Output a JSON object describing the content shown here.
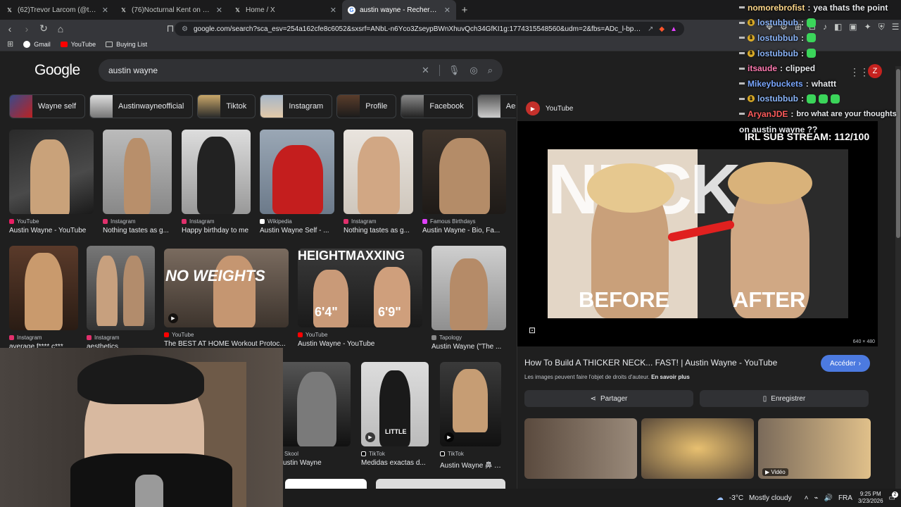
{
  "tabs": [
    {
      "title": "(62)Trevor Larcom (@trevorlarcom) |",
      "icon": "x-icon",
      "color": "#ffffff"
    },
    {
      "title": "(76)Nocturnal Kent on Zyzz: 7NEWS",
      "icon": "x-icon",
      "color": "#ffffff"
    },
    {
      "title": "Home / X",
      "icon": "x-icon",
      "color": "#ffffff"
    },
    {
      "title": "austin wayne - Recherche Google",
      "icon": "google-icon",
      "color": "#4285f4",
      "active": true
    }
  ],
  "address_bar": {
    "url": "google.com/search?sca_esv=254a162cfe8c6052&sxsrf=ANbL-n6Yco3ZseypBWnXhuvQch34GfKI1g:1774315548560&udm=2&fbs=ADc_l-bpk8W4E-q..."
  },
  "bookmarks": [
    "Gmail",
    "YouTube",
    "Buying List"
  ],
  "google": {
    "logo": "Google",
    "query": "austin wayne"
  },
  "chips": [
    "Wayne self",
    "Austinwayneofficial",
    "Tiktok",
    "Instagram",
    "Profile",
    "Facebook",
    "Aesthetics"
  ],
  "results": [
    {
      "source": "YouTube",
      "title": "Austin Wayne - YouTube"
    },
    {
      "source": "Instagram",
      "title": "Nothing tastes as g..."
    },
    {
      "source": "Instagram",
      "title": "Happy birthday to me"
    },
    {
      "source": "Wikipedia",
      "title": "Austin Wayne Self - ..."
    },
    {
      "source": "Instagram",
      "title": "Nothing tastes as g..."
    },
    {
      "source": "Famous Birthdays",
      "title": "Austin Wayne - Bio, Fa..."
    },
    {
      "source": "Instagram",
      "title": "average f**** c***"
    },
    {
      "source": "Instagram",
      "title": "aesthetics"
    },
    {
      "source": "YouTube",
      "title": "The BEST AT HOME Workout Protoc..."
    },
    {
      "source": "YouTube",
      "title": "Austin Wayne - YouTube"
    },
    {
      "source": "Tapology",
      "title": "Austin Wayne (\"The ..."
    },
    {
      "source": "Skool",
      "title": "ustin Wayne"
    },
    {
      "source": "TikTok",
      "title": "Medidas exactas d..."
    },
    {
      "source": "TikTok",
      "title": "Austin Wayne 鼻 | ..."
    }
  ],
  "thumb_text": {
    "no_weights": "NO WEIGHTS",
    "heightmaxxing": "HEIGHTMAXXING",
    "h1": "6'4\"",
    "h2": "6'9\"",
    "little": "LITTLE"
  },
  "preview": {
    "source": "YouTube",
    "before": "BEFORE",
    "after": "AFTER",
    "neck": "NECK",
    "dimensions": "640 × 480",
    "title": "How To Build A THICKER NECK... FAST! | Austin Wayne - YouTube",
    "visit": "Accéder",
    "copyright": "Les images peuvent faire l'objet de droits d'auteur.",
    "learn_more": "En savoir plus",
    "share": "Partager",
    "save": "Enregistrer",
    "video_badge": "Vidéo"
  },
  "chat": [
    {
      "user": "nomorebrofist",
      "msg": "yea thats the point",
      "color": "#ffd88a",
      "badge": "none"
    },
    {
      "user": "lostubbub",
      "msg": "",
      "color": "#8ab4f8",
      "badge": "gold",
      "emotes": 1
    },
    {
      "user": "lostubbub",
      "msg": "",
      "color": "#8ab4f8",
      "badge": "gold",
      "emotes": 1
    },
    {
      "user": "lostubbub",
      "msg": "",
      "color": "#8ab4f8",
      "badge": "gold",
      "emotes": 1
    },
    {
      "user": "itsaude",
      "msg": "clipped",
      "color": "#ff7ab0",
      "badge": "dash"
    },
    {
      "user": "Mikeybuckets",
      "msg": "whattt",
      "color": "#7aa7ff",
      "badge": "dash"
    },
    {
      "user": "lostubbub",
      "msg": "",
      "color": "#8ab4f8",
      "badge": "gold",
      "emotes": 3
    },
    {
      "user": "AryanJDE",
      "msg": "bro what are your thoughts",
      "color": "#ff5c5c",
      "badge": "dash"
    }
  ],
  "chat_continuation": "on austin wayne ??",
  "overlay": {
    "sub_stream": "IRL SUB STREAM: 112/100"
  },
  "account_initial": "Z",
  "taskbar": {
    "temp": "-3°C",
    "weather": "Mostly cloudy",
    "lang": "FRA",
    "time": "9:25 PM",
    "date": "3/23/2026",
    "notif": "2"
  }
}
